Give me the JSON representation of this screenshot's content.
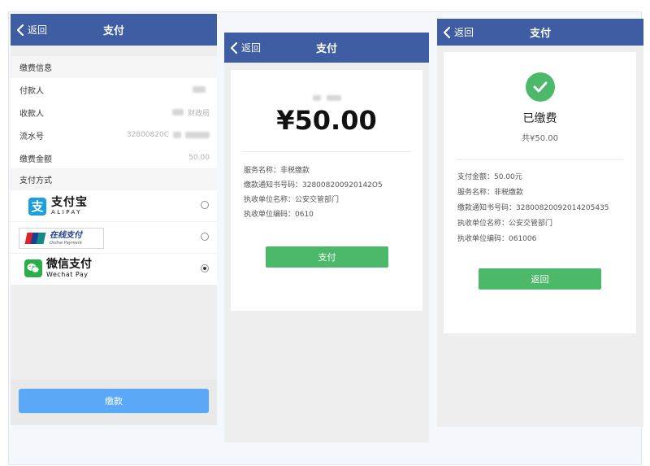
{
  "colors": {
    "navbar": "#3f5da2",
    "primary_button": "#5aa8f7",
    "success_green": "#4bb86a",
    "alipay_blue": "#1a9fe0",
    "wechat_green": "#2aae49"
  },
  "screen1": {
    "nav": {
      "back": "返回",
      "title": "支付"
    },
    "section_fee_info": "缴费信息",
    "fields": [
      {
        "label": "付款人",
        "value": ""
      },
      {
        "label": "收款人",
        "value": "财政局"
      },
      {
        "label": "流水号",
        "value": "32800820C"
      },
      {
        "label": "缴费金额",
        "value": "50.00"
      }
    ],
    "section_pay_method": "支付方式",
    "methods": {
      "alipay": {
        "name": "支付宝",
        "sub": "ALIPAY",
        "icon": "alipay-icon",
        "selected": false
      },
      "unionpay": {
        "name": "在线支付",
        "sub": "Online Payment",
        "badge": "UnionPay 银联",
        "icon": "unionpay-icon",
        "selected": false
      },
      "wechat": {
        "name": "微信支付",
        "sub": "Wechat Pay",
        "icon": "wechat-icon",
        "selected": true
      }
    },
    "submit": "缴款"
  },
  "screen2": {
    "nav": {
      "back": "返回",
      "title": "支付"
    },
    "amount": "¥50.00",
    "service_name": "服务名称：非税缴款",
    "notice_no": "缴款通知书号码：328008200920142O5",
    "unit_name": "执收单位名称：公安交管部门",
    "unit_code": "执收单位编码：0610",
    "pay_button": "支付"
  },
  "screen3": {
    "nav": {
      "back": "返回",
      "title": "支付"
    },
    "status": "已缴费",
    "total": "共¥50.00",
    "details": [
      "支付金额：50.00元",
      "服务名称：非税缴款",
      "缴款通知书号码：32800820092014205435",
      "执收单位名称：公安交管部门",
      "执收单位编码：061006"
    ],
    "back_button": "返回"
  }
}
